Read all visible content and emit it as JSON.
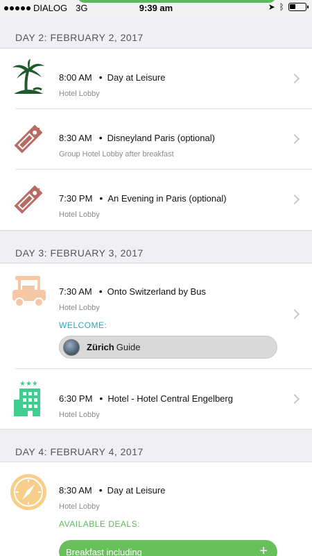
{
  "status": {
    "carrier": "DIALOG",
    "network": "3G",
    "time": "9:39 am"
  },
  "days": [
    {
      "header": "DAY 2: FEBRUARY 2, 2017",
      "items": [
        {
          "time": "8:00 AM",
          "title": "Day at Leisure",
          "location": "Hotel Lobby",
          "icon": "palm-tree-icon"
        },
        {
          "time": "8:30 AM",
          "title": "Disneyland Paris (optional)",
          "location": "Group Hotel Lobby after breakfast",
          "icon": "price-tag-icon"
        },
        {
          "time": "7:30 PM",
          "title": "An Evening in Paris (optional)",
          "location": "Hotel Lobby",
          "icon": "price-tag-icon"
        }
      ]
    },
    {
      "header": "DAY 3: FEBRUARY 3, 2017",
      "items": [
        {
          "time": "7:30 AM",
          "title": "Onto Switzerland by Bus",
          "location": "Hotel Lobby",
          "icon": "cart-vehicle-icon",
          "welcome_label": "WELCOME:",
          "guide_name": "Zürich",
          "guide_suffix": "Guide"
        },
        {
          "time": "6:30 PM",
          "title": "Hotel -  Hotel Central Engelberg",
          "location": "Hotel Lobby",
          "icon": "hotel-building-icon"
        }
      ]
    },
    {
      "header": "DAY 4: FEBRUARY 4, 2017",
      "items": [
        {
          "time": "8:30 AM",
          "title": "Day at Leisure",
          "location": "Hotel Lobby",
          "icon": "compass-icon",
          "deals_label": "AVAILABLE DEALS:",
          "deal_button": "Breakfast including",
          "deal_plus": "+"
        }
      ]
    }
  ],
  "colors": {
    "palm": "#1f5a2a",
    "tag": "#b86b63",
    "cart": "#f5c7a6",
    "hotel": "#3ecf8e",
    "compass": "#f7cf8a",
    "welcome": "#2aa8c4",
    "deal": "#67c05a"
  }
}
